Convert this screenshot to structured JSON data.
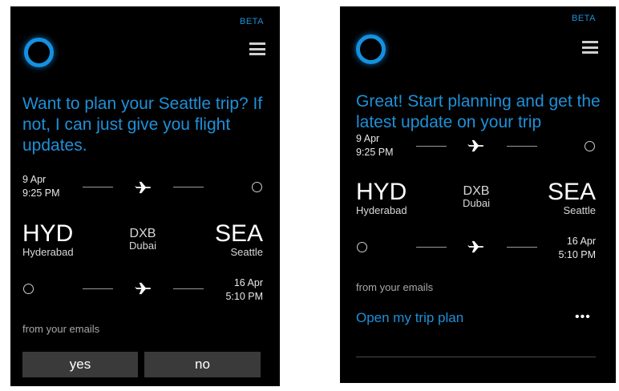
{
  "left": {
    "beta": "BETA",
    "question": "Want to plan your Seattle trip? If not, I can just give you flight updates.",
    "outbound": {
      "date": "9 Apr",
      "time": "9:25 PM"
    },
    "origin": {
      "code": "HYD",
      "city": "Hyderabad"
    },
    "layover": {
      "code": "DXB",
      "city": "Dubai"
    },
    "destination": {
      "code": "SEA",
      "city": "Seattle"
    },
    "return": {
      "date": "16 Apr",
      "time": "5:10 PM"
    },
    "source": "from your emails",
    "yes_label": "yes",
    "no_label": "no"
  },
  "right": {
    "beta": "BETA",
    "message": "Great! Start planning and get the latest update on your trip",
    "outbound": {
      "date": "9 Apr",
      "time": "9:25 PM"
    },
    "origin": {
      "code": "HYD",
      "city": "Hyderabad"
    },
    "layover": {
      "code": "DXB",
      "city": "Dubai"
    },
    "destination": {
      "code": "SEA",
      "city": "Seattle"
    },
    "return": {
      "date": "16 Apr",
      "time": "5:10 PM"
    },
    "source": "from your emails",
    "open_plan_label": "Open my trip plan",
    "more_label": "•••"
  },
  "icons": [
    "cortana-icon",
    "hamburger-menu-icon",
    "airplane-icon",
    "circle-icon",
    "more-icon"
  ],
  "colors": {
    "accent": "#1e90d8",
    "background": "#000000",
    "button": "#3a3a3a"
  }
}
